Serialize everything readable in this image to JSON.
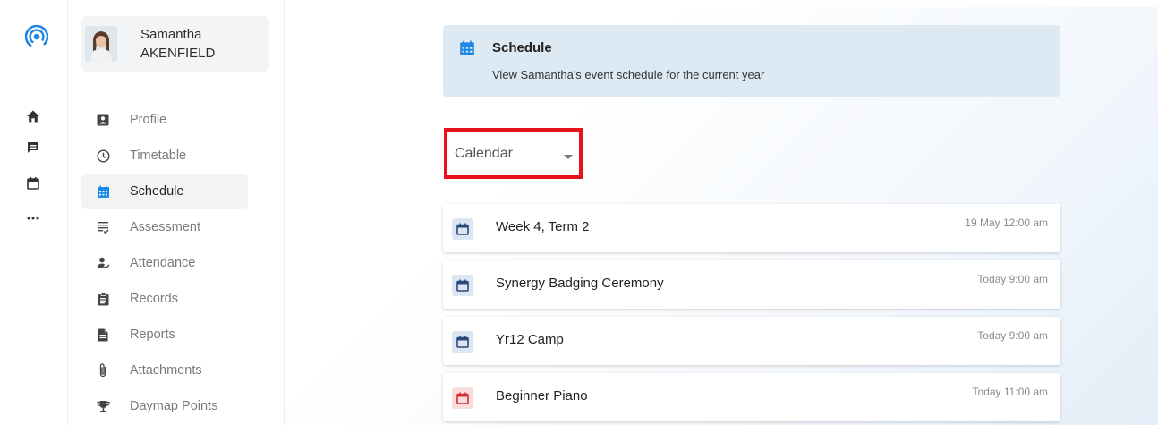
{
  "colors": {
    "accent": "#1e88e5",
    "highlight": "#e8121b",
    "event_blue_bg": "#dbe6f2",
    "event_red_bg": "#f9dcdc"
  },
  "rail": {
    "icons": [
      "logo-icon",
      "home-icon",
      "chat-icon",
      "calendar-icon",
      "more-icon"
    ]
  },
  "profile": {
    "first_name": "Samantha",
    "last_name": "AKENFIELD"
  },
  "nav": {
    "items": [
      {
        "label": "Profile",
        "icon": "id-card-icon"
      },
      {
        "label": "Timetable",
        "icon": "clock-icon"
      },
      {
        "label": "Schedule",
        "icon": "calendar-grid-icon",
        "active": true
      },
      {
        "label": "Assessment",
        "icon": "list-check-icon"
      },
      {
        "label": "Attendance",
        "icon": "person-check-icon"
      },
      {
        "label": "Records",
        "icon": "clipboard-icon"
      },
      {
        "label": "Reports",
        "icon": "document-icon"
      },
      {
        "label": "Attachments",
        "icon": "paperclip-icon"
      },
      {
        "label": "Daymap Points",
        "icon": "trophy-icon"
      }
    ]
  },
  "banner": {
    "title": "Schedule",
    "subtitle": "View Samantha's event schedule for the current year"
  },
  "view_select": {
    "value": "Calendar"
  },
  "events": [
    {
      "title": "Week 4, Term 2",
      "time": "19 May 12:00 am",
      "color": "blue"
    },
    {
      "title": "Synergy Badging Ceremony",
      "time": "Today 9:00 am",
      "color": "blue"
    },
    {
      "title": "Yr12 Camp",
      "time": "Today 9:00 am",
      "color": "blue"
    },
    {
      "title": "Beginner Piano",
      "time": "Today 11:00 am",
      "color": "red"
    }
  ]
}
